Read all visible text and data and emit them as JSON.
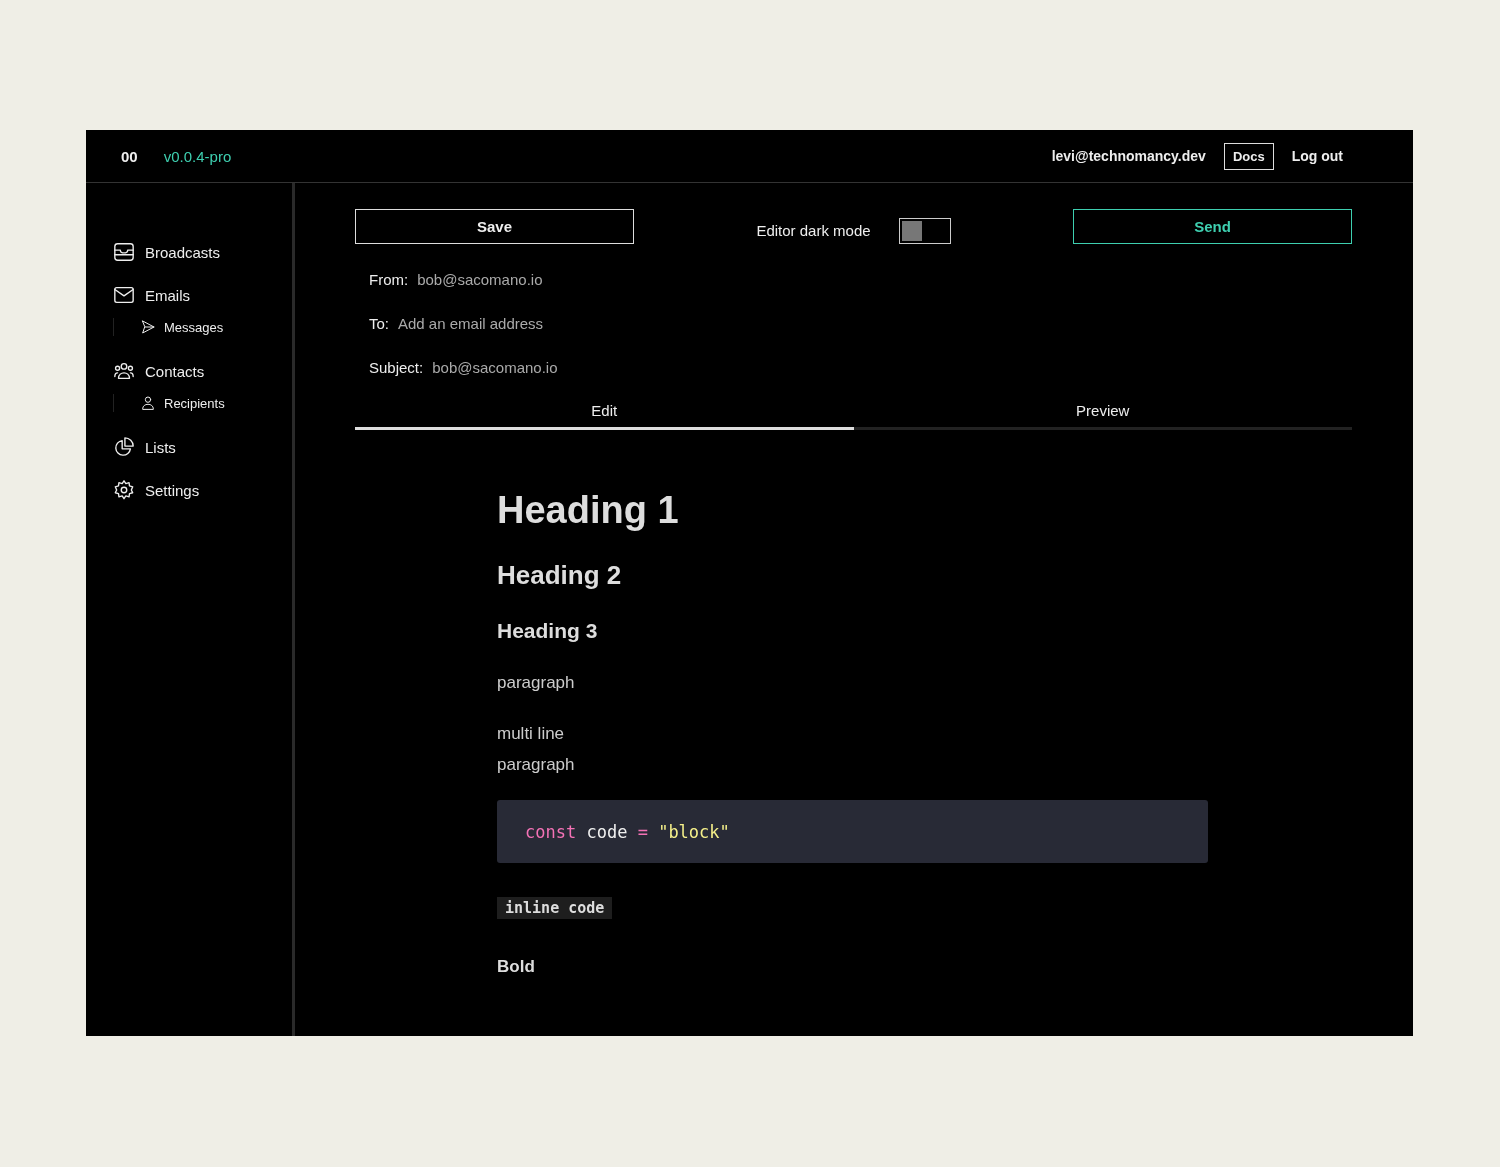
{
  "header": {
    "logo": "00",
    "version": "v0.0.4-pro",
    "user": "levi@technomancy.dev",
    "docs": "Docs",
    "logout": "Log out"
  },
  "sidebar": {
    "items": [
      {
        "label": "Broadcasts"
      },
      {
        "label": "Emails",
        "children": [
          {
            "label": "Messages"
          }
        ]
      },
      {
        "label": "Contacts",
        "children": [
          {
            "label": "Recipients"
          }
        ]
      },
      {
        "label": "Lists"
      },
      {
        "label": "Settings"
      }
    ]
  },
  "toolbar": {
    "save": "Save",
    "dark_mode": {
      "label": "Editor dark mode",
      "on": false
    },
    "send": "Send"
  },
  "fields": [
    {
      "label": "From:",
      "value": "bob@sacomano.io"
    },
    {
      "label": "To:",
      "placeholder": "Add an email address"
    },
    {
      "label": "Subject:",
      "value": "bob@sacomano.io"
    }
  ],
  "tabs": [
    {
      "label": "Edit",
      "selected": true
    },
    {
      "label": "Preview",
      "selected": false
    }
  ],
  "editor": [
    {
      "kind": "h1",
      "text": "Heading 1"
    },
    {
      "kind": "h2",
      "text": "Heading 2"
    },
    {
      "kind": "h3",
      "text": "Heading 3"
    },
    {
      "kind": "paragraph",
      "text": "paragraph"
    },
    {
      "kind": "paragraph",
      "text": "multi line\nparagraph"
    },
    {
      "kind": "code_block",
      "tokens": [
        {
          "kind": "keyword",
          "text": "const"
        },
        {
          "kind": "plain",
          "text": "code"
        },
        {
          "kind": "operator",
          "text": "="
        },
        {
          "kind": "string",
          "text": "\"block\""
        }
      ]
    },
    {
      "kind": "inline_code",
      "text": "inline code"
    },
    {
      "kind": "bold",
      "text": "Bold"
    }
  ]
}
